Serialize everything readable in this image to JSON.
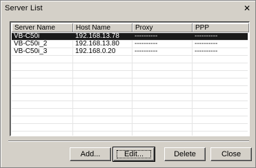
{
  "window": {
    "title": "Server List",
    "close_glyph": "✕"
  },
  "list": {
    "columns": [
      "Server Name",
      "Host Name",
      "Proxy",
      "PPP"
    ],
    "rows": [
      {
        "server": "VB-C50i",
        "host": "192.168.13.78",
        "proxy": "----------",
        "ppp": "----------",
        "selected": true
      },
      {
        "server": "VB-C50i_2",
        "host": "192.168.13.80",
        "proxy": "----------",
        "ppp": "----------",
        "selected": false
      },
      {
        "server": "VB-C50i_3",
        "host": "192.168.0.20",
        "proxy": "----------",
        "ppp": "----------",
        "selected": false
      }
    ],
    "empty_rows": 14
  },
  "buttons": {
    "add": "Add...",
    "edit": "Edit...",
    "delete": "Delete",
    "close": "Close"
  },
  "colors": {
    "face": "#d4d0c8",
    "selection": "#1a1a1a",
    "list_bg": "#ffffff"
  }
}
